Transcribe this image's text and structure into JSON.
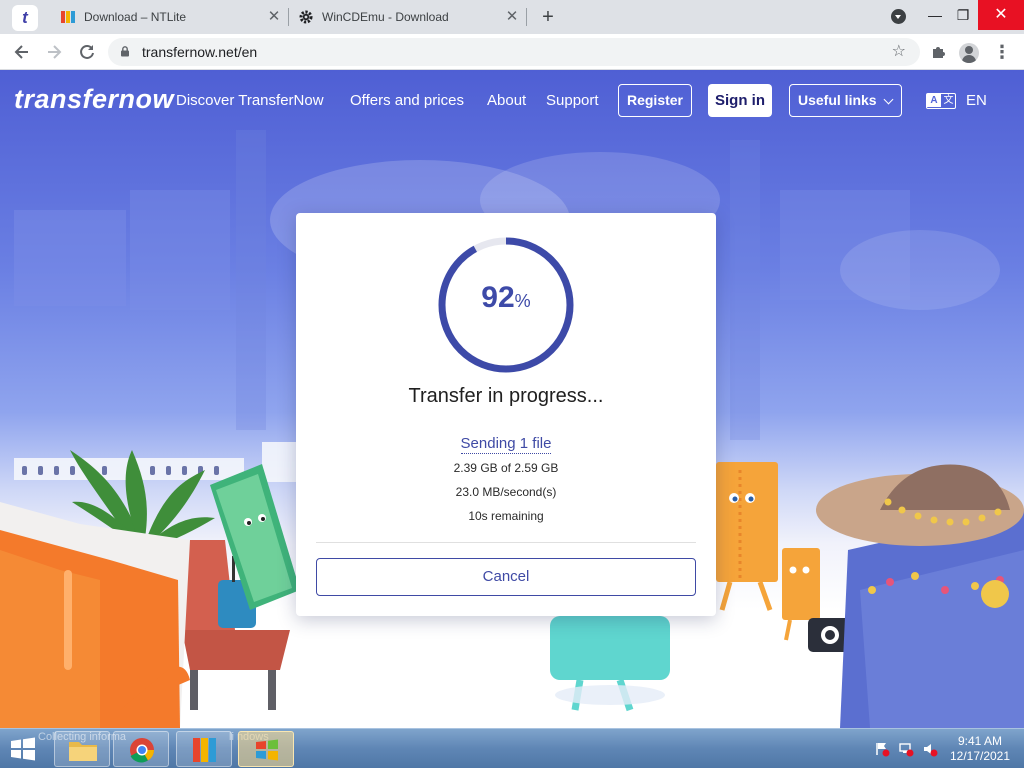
{
  "browser": {
    "tabs": [
      {
        "title": "",
        "favicon": "transfernow-t-icon",
        "favicon_letter": "t"
      },
      {
        "title": "Download – NTLite",
        "favicon": "ntlite-icon"
      },
      {
        "title": "WinCDEmu - Download",
        "favicon": "gear-icon"
      }
    ],
    "new_tab_symbol": "+",
    "window_controls": {
      "minimize": "—",
      "restore": "❐",
      "close": "✕"
    },
    "url": "transfernow.net/en"
  },
  "site": {
    "logo": "transfernow",
    "nav": [
      "Discover TransferNow",
      "Offers and prices",
      "About",
      "Support"
    ],
    "register": "Register",
    "signin": "Sign in",
    "useful_links": "Useful links",
    "lang_icon_left": "A",
    "lang_icon_right": "文",
    "lang_code": "EN"
  },
  "transfer": {
    "progress_percent": 92,
    "percent_symbol": "%",
    "title": "Transfer in progress...",
    "sending": "Sending 1 file",
    "size": "2.39 GB of 2.59 GB",
    "speed": "23.0 MB/second(s)",
    "remaining": "10s remaining",
    "cancel": "Cancel"
  },
  "taskbar": {
    "status_text_left": "Collecting informa",
    "status_text_right": "li            ndows",
    "time": "9:41 AM",
    "date": "12/17/2021"
  },
  "colors": {
    "accent": "#3f4aa5",
    "ring_progress": "#3d4aa8",
    "ring_track": "#e6e7ef",
    "page_top": "#4f5fd4"
  }
}
